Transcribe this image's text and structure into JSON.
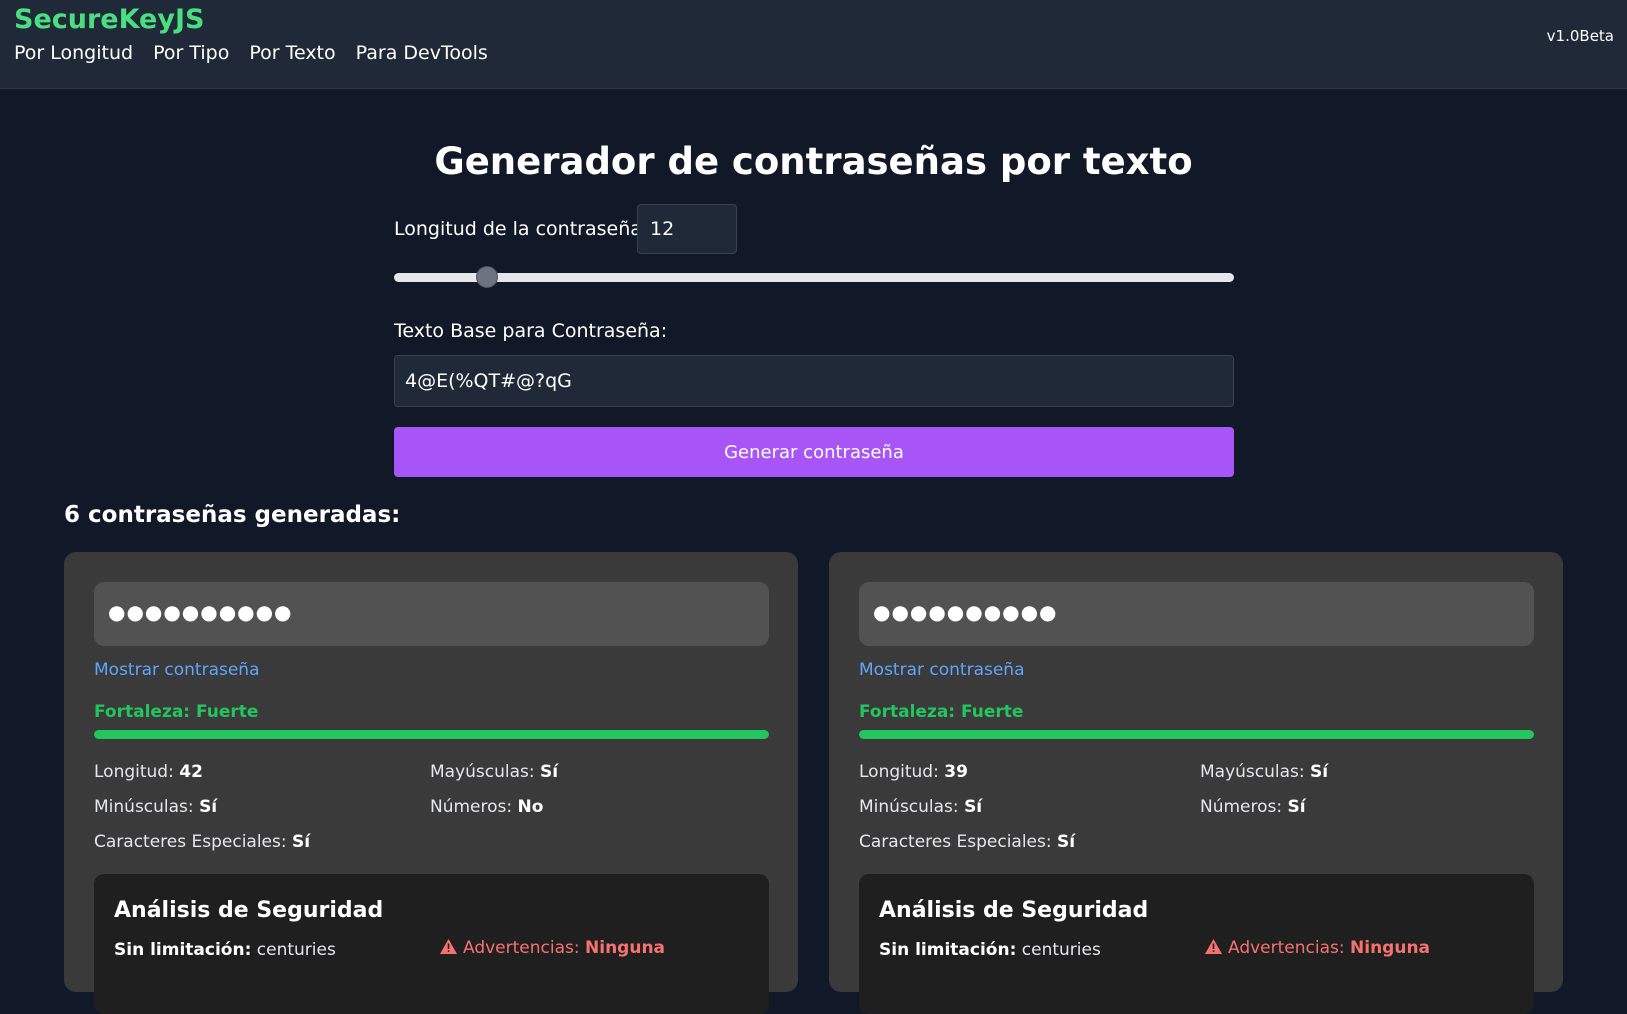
{
  "header": {
    "brand": "SecureKeyJS",
    "nav": [
      "Por Longitud",
      "Por Tipo",
      "Por Texto",
      "Para DevTools"
    ],
    "version": "v1.0Beta"
  },
  "main": {
    "title": "Generador de contraseñas por texto",
    "length_label": "Longitud de la contraseña:",
    "length_value": "12",
    "length_slider_fraction": 0.11,
    "base_text_label": "Texto Base para Contraseña:",
    "base_text_value": "4@E(%QT#@?qG",
    "generate_button": "Generar contraseña",
    "results_title": "6 contraseñas generadas:"
  },
  "cards": [
    {
      "masked_password": "●●●●●●●●●●",
      "show_link": "Mostrar contraseña",
      "strength": "Fortaleza: Fuerte",
      "strength_fraction": 1.0,
      "length_label": "Longitud:",
      "length": "42",
      "upper_label": "Mayúsculas:",
      "upper": "Sí",
      "lower_label": "Minúsculas:",
      "lower": "Sí",
      "numbers_label": "Números:",
      "numbers": "No",
      "special_label": "Caracteres Especiales:",
      "special": "Sí",
      "analysis_title": "Análisis de Seguridad",
      "unlimited_label": "Sin limitación:",
      "unlimited": "centuries",
      "warnings_label": "Advertencias:",
      "warnings": "Ninguna"
    },
    {
      "masked_password": "●●●●●●●●●●",
      "show_link": "Mostrar contraseña",
      "strength": "Fortaleza: Fuerte",
      "strength_fraction": 1.0,
      "length_label": "Longitud:",
      "length": "39",
      "upper_label": "Mayúsculas:",
      "upper": "Sí",
      "lower_label": "Minúsculas:",
      "lower": "Sí",
      "numbers_label": "Números:",
      "numbers": "Sí",
      "special_label": "Caracteres Especiales:",
      "special": "Sí",
      "analysis_title": "Análisis de Seguridad",
      "unlimited_label": "Sin limitación:",
      "unlimited": "centuries",
      "warnings_label": "Advertencias:",
      "warnings": "Ninguna"
    }
  ],
  "icons": {
    "warning": "warning-triangle-icon"
  },
  "colors": {
    "background": "#111827",
    "header_bg": "#1f2937",
    "brand": "#4ade80",
    "button": "#a855f7",
    "link": "#60a5fa",
    "strength": "#22c55e",
    "warning": "#f87171",
    "card_bg": "#3a3a3a"
  }
}
